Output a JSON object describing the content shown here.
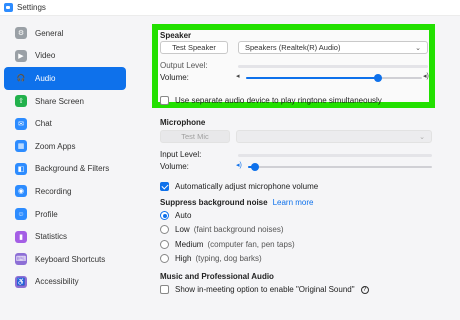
{
  "window": {
    "title": "Settings"
  },
  "sidebar": {
    "items": [
      {
        "label": "General",
        "icon": "gear-icon",
        "color": "#9aa0a6",
        "glyph": "⚙",
        "active": false
      },
      {
        "label": "Video",
        "icon": "video-icon",
        "color": "#9aa0a6",
        "glyph": "▶",
        "active": false
      },
      {
        "label": "Audio",
        "icon": "headphones-icon",
        "color": "#0e71eb",
        "glyph": "🎧",
        "active": true
      },
      {
        "label": "Share Screen",
        "icon": "share-screen-icon",
        "color": "#22b14c",
        "glyph": "⇧",
        "active": false
      },
      {
        "label": "Chat",
        "icon": "chat-icon",
        "color": "#2d8cff",
        "glyph": "✉",
        "active": false
      },
      {
        "label": "Zoom Apps",
        "icon": "apps-icon",
        "color": "#2d8cff",
        "glyph": "▦",
        "active": false
      },
      {
        "label": "Background & Filters",
        "icon": "background-icon",
        "color": "#2d8cff",
        "glyph": "◧",
        "active": false
      },
      {
        "label": "Recording",
        "icon": "recording-icon",
        "color": "#2d8cff",
        "glyph": "◉",
        "active": false
      },
      {
        "label": "Profile",
        "icon": "profile-icon",
        "color": "#2d8cff",
        "glyph": "☺",
        "active": false
      },
      {
        "label": "Statistics",
        "icon": "statistics-icon",
        "color": "#a45ee5",
        "glyph": "▮",
        "active": false
      },
      {
        "label": "Keyboard Shortcuts",
        "icon": "keyboard-icon",
        "color": "#8d6fd6",
        "glyph": "⌨",
        "active": false
      },
      {
        "label": "Accessibility",
        "icon": "accessibility-icon",
        "color": "#8d6fd6",
        "glyph": "♿",
        "active": false
      }
    ]
  },
  "speaker": {
    "title": "Speaker",
    "test_button": "Test Speaker",
    "device": "Speakers (Realtek(R) Audio)",
    "output_level_label": "Output Level:",
    "volume_label": "Volume:",
    "volume_value": 0.75,
    "highlight_color": "#22e000"
  },
  "ringtone_option": {
    "label": "Use separate audio device to play ringtone simultaneously",
    "checked": false
  },
  "microphone": {
    "title": "Microphone",
    "test_button": "Test Mic",
    "input_level_label": "Input Level:",
    "volume_label": "Volume:",
    "volume_value": 0.04
  },
  "auto_adjust": {
    "label": "Automatically adjust microphone volume",
    "checked": true
  },
  "noise": {
    "title": "Suppress background noise",
    "learn_more": "Learn more",
    "options": [
      {
        "label": "Auto",
        "hint": "",
        "checked": true
      },
      {
        "label": "Low",
        "hint": "(faint background noises)",
        "checked": false
      },
      {
        "label": "Medium",
        "hint": "(computer fan, pen taps)",
        "checked": false
      },
      {
        "label": "High",
        "hint": "(typing, dog barks)",
        "checked": false
      }
    ]
  },
  "music": {
    "title": "Music and Professional Audio",
    "original_sound": "Show in-meeting option to enable \"Original Sound\"",
    "help_glyph": "?"
  },
  "accent_color": "#0e71eb"
}
